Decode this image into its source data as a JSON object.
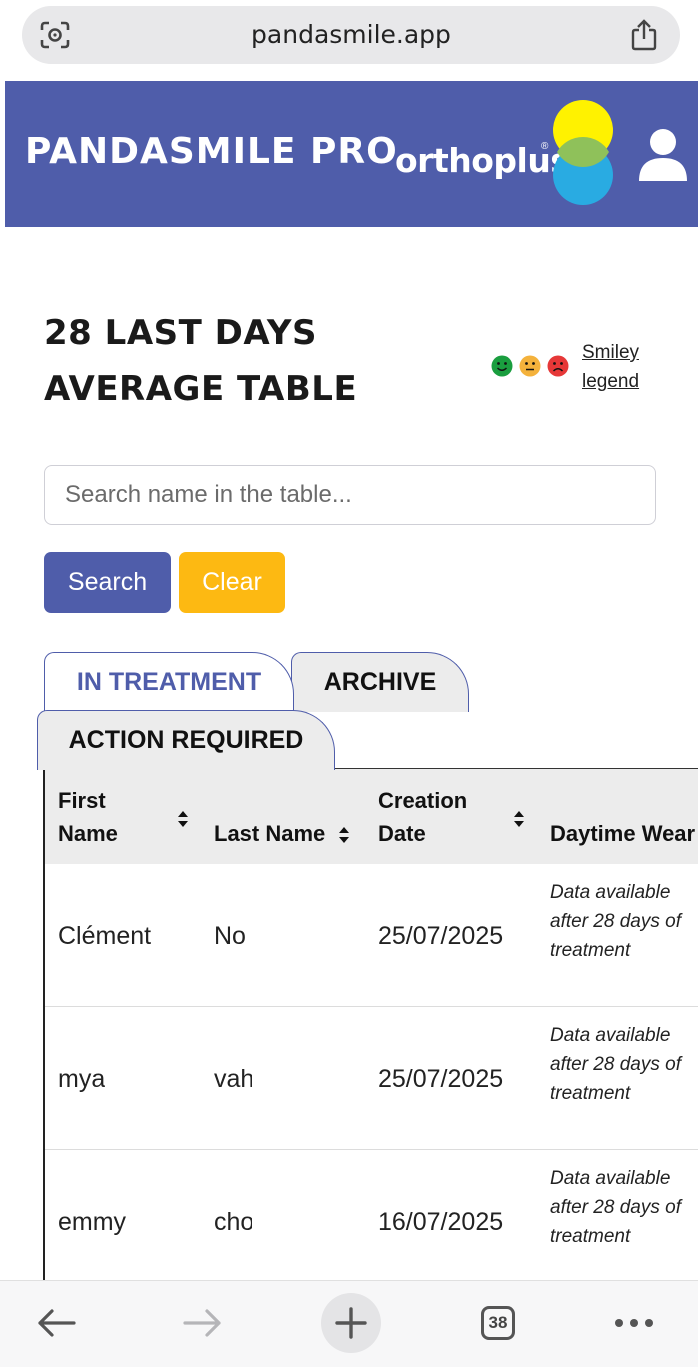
{
  "browser": {
    "url": "pandasmile.app"
  },
  "header": {
    "brand": "PANDASMILE PRO",
    "brand_secondary": "orthoplus",
    "registered_mark": "®",
    "colors": {
      "background": "#4f5daa",
      "yellow": "#fff200",
      "blue": "#29abe2"
    }
  },
  "page": {
    "title_line1": "28 LAST DAYS",
    "title_line2": "AVERAGE TABLE",
    "smiley_legend_line1": "Smiley",
    "smiley_legend_line2": "legend",
    "smileys": [
      {
        "name": "happy",
        "color": "#1a9e3f"
      },
      {
        "name": "neutral",
        "color": "#f4b23c"
      },
      {
        "name": "sad",
        "color": "#e63838"
      }
    ]
  },
  "search": {
    "placeholder": "Search name in the table...",
    "search_label": "Search",
    "clear_label": "Clear"
  },
  "tabs": [
    {
      "label": "IN TREATMENT",
      "active": true
    },
    {
      "label": "ARCHIVE",
      "active": false
    },
    {
      "label": "ACTION REQUIRED",
      "active": false
    }
  ],
  "table": {
    "headers": {
      "first_name_1": "First",
      "first_name_2": "Name",
      "last_name": "Last Name",
      "creation_1": "Creation",
      "creation_2": "Date",
      "daytime_wear": "Daytime Wear"
    },
    "rows": [
      {
        "first": "Clément",
        "last": "No",
        "date": "25/07/2025",
        "note": "Data available after 28 days of treatment"
      },
      {
        "first": "mya",
        "last": "vah",
        "date": "25/07/2025",
        "note": "Data available after 28 days of treatment"
      },
      {
        "first": "emmy",
        "last": "cho",
        "date": "16/07/2025",
        "note": "Data available after 28 days of treatment"
      }
    ]
  },
  "bottom_bar": {
    "tab_count": "38"
  }
}
